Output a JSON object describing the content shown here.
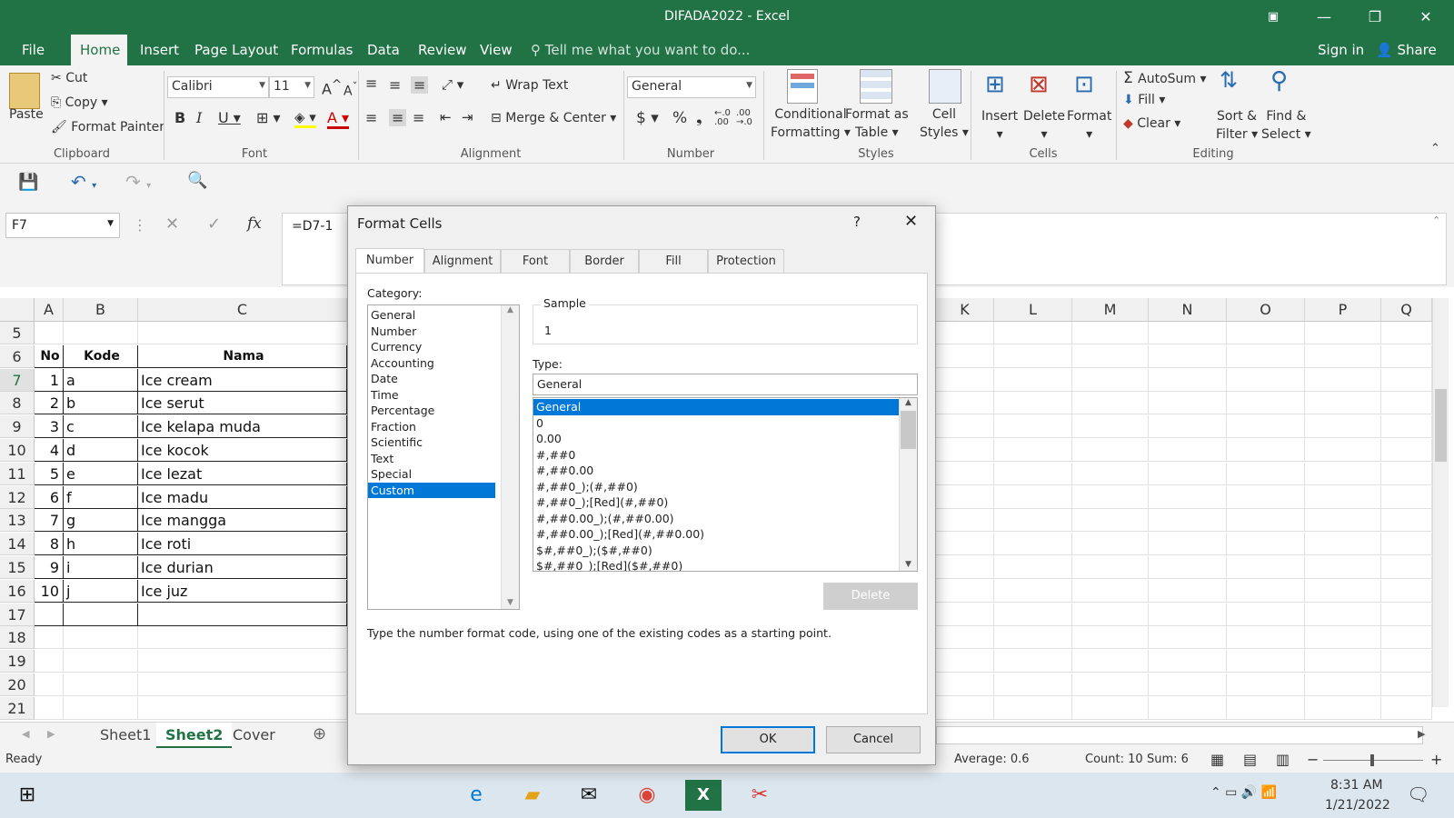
{
  "window": {
    "title": "DIFADA2022 - Excel"
  },
  "ribbon_tabs": [
    "File",
    "Home",
    "Insert",
    "Page Layout",
    "Formulas",
    "Data",
    "Review",
    "View"
  ],
  "tell_me": "Tell me what you want to do...",
  "account": {
    "sign_in": "Sign in",
    "share": "Share"
  },
  "clipboard": {
    "paste": "Paste",
    "cut": "Cut",
    "copy": "Copy",
    "format_painter": "Format Painter",
    "label": "Clipboard"
  },
  "font": {
    "name": "Calibri",
    "size": "11",
    "label": "Font"
  },
  "alignment": {
    "wrap": "Wrap Text",
    "merge": "Merge & Center",
    "label": "Alignment"
  },
  "number": {
    "format": "General",
    "label": "Number"
  },
  "styles": {
    "conditional": "Conditional",
    "conditional2": "Formatting",
    "format_as": "Format as",
    "format_as2": "Table",
    "cell": "Cell",
    "cell2": "Styles",
    "label": "Styles"
  },
  "cells": {
    "insert": "Insert",
    "delete": "Delete",
    "format": "Format",
    "label": "Cells"
  },
  "editing": {
    "autosum": "AutoSum",
    "fill": "Fill",
    "clear": "Clear",
    "sort": "Sort &",
    "sort2": "Filter",
    "find": "Find &",
    "find2": "Select",
    "label": "Editing"
  },
  "formula_bar": {
    "name_box": "F7",
    "formula": "=D7-1"
  },
  "columns_left": [
    "A",
    "B",
    "C"
  ],
  "columns_right": [
    "K",
    "L",
    "M",
    "N",
    "O",
    "P",
    "Q"
  ],
  "rows": [
    "5",
    "6",
    "7",
    "8",
    "9",
    "10",
    "11",
    "12",
    "13",
    "14",
    "15",
    "16",
    "17",
    "18",
    "19",
    "20",
    "21"
  ],
  "table": {
    "headers": [
      "No",
      "Kode",
      "Nama"
    ],
    "rows": [
      [
        "1",
        "a",
        "Ice cream"
      ],
      [
        "2",
        "b",
        "Ice serut"
      ],
      [
        "3",
        "c",
        "Ice kelapa muda"
      ],
      [
        "4",
        "d",
        "Ice kocok"
      ],
      [
        "5",
        "e",
        "Ice lezat"
      ],
      [
        "6",
        "f",
        "Ice madu"
      ],
      [
        "7",
        "g",
        "Ice mangga"
      ],
      [
        "8",
        "h",
        "Ice roti"
      ],
      [
        "9",
        "i",
        "Ice durian"
      ],
      [
        "10",
        "j",
        "Ice juz"
      ]
    ]
  },
  "sheets": [
    "Sheet1",
    "Sheet2",
    "Cover"
  ],
  "status": {
    "ready": "Ready",
    "average": "Average: 0.6",
    "count": "Count: 10",
    "sum": "Sum: 6"
  },
  "taskbar": {
    "time": "8:31 AM",
    "date": "1/21/2022"
  },
  "dialog": {
    "title": "Format Cells",
    "help": "?",
    "tabs": [
      "Number",
      "Alignment",
      "Font",
      "Border",
      "Fill",
      "Protection"
    ],
    "category_label": "Category:",
    "categories": [
      "General",
      "Number",
      "Currency",
      "Accounting",
      "Date",
      "Time",
      "Percentage",
      "Fraction",
      "Scientific",
      "Text",
      "Special",
      "Custom"
    ],
    "selected_category": "Custom",
    "sample_label": "Sample",
    "sample_value": "1",
    "type_label": "Type:",
    "type_value": "General",
    "types": [
      "General",
      "0",
      "0.00",
      "#,##0",
      "#,##0.00",
      "#,##0_);(#,##0)",
      "#,##0_);[Red](#,##0)",
      "#,##0.00_);(#,##0.00)",
      "#,##0.00_);[Red](#,##0.00)",
      "$#,##0_);($#,##0)",
      "$#,##0_);[Red]($#,##0)"
    ],
    "delete": "Delete",
    "hint": "Type the number format code, using one of the existing codes as a starting point.",
    "ok": "OK",
    "cancel": "Cancel"
  }
}
